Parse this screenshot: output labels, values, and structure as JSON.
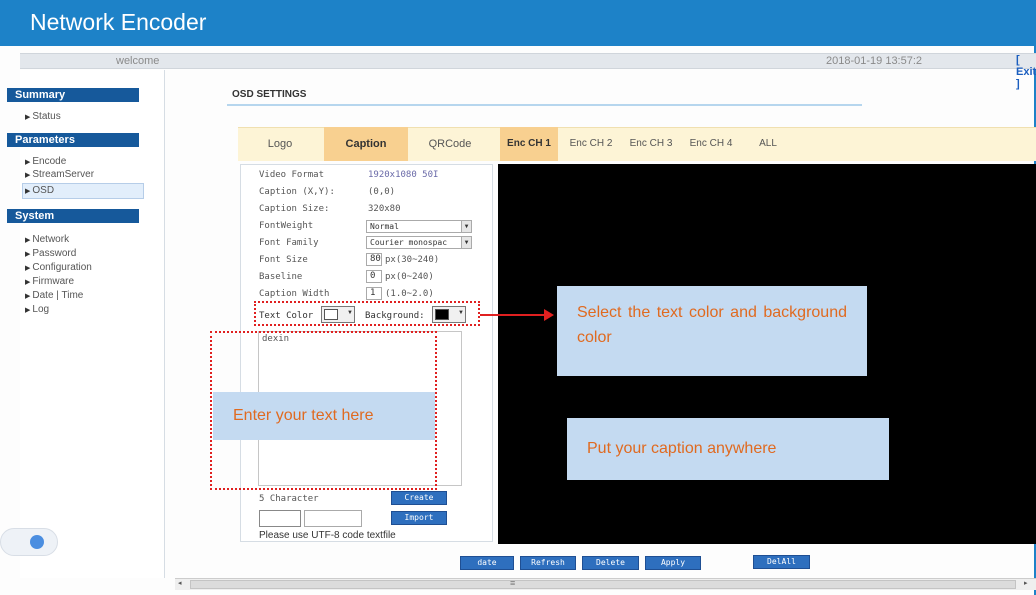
{
  "app": {
    "title": "Network Encoder"
  },
  "topbar": {
    "welcome": "welcome",
    "datetime": "2018-01-19 13:57:2",
    "exit_label": "[ Exit ]"
  },
  "sidebar": {
    "sections": [
      {
        "title": "Summary",
        "items": [
          "Status"
        ]
      },
      {
        "title": "Parameters",
        "items": [
          "Encode",
          "StreamServer",
          "OSD"
        ]
      },
      {
        "title": "System",
        "items": [
          "Network",
          "Password",
          "Configuration",
          "Firmware",
          "Date | Time",
          "Log"
        ]
      }
    ],
    "active_item": "OSD"
  },
  "page": {
    "title": "OSD SETTINGS"
  },
  "osd_tabs": [
    {
      "label": "Logo",
      "active": false
    },
    {
      "label": "Caption",
      "active": true
    },
    {
      "label": "QRCode",
      "active": false
    }
  ],
  "channel_tabs": [
    {
      "label": "Enc CH 1",
      "active": true
    },
    {
      "label": "Enc CH 2",
      "active": false
    },
    {
      "label": "Enc CH 3",
      "active": false
    },
    {
      "label": "Enc CH 4",
      "active": false
    },
    {
      "label": "ALL",
      "active": false
    }
  ],
  "form": {
    "video_format_label": "Video Format",
    "video_format_value": "1920x1080 50I",
    "caption_xy_label": "Caption (X,Y):",
    "caption_xy_value": "(0,0)",
    "caption_size_label": "Caption Size:",
    "caption_size_value": "320x80",
    "font_weight_label": "FontWeight",
    "font_weight_value": "Normal",
    "font_family_label": "Font Family",
    "font_family_value": "Courier monospac",
    "font_size_label": "Font Size",
    "font_size_value": "80",
    "font_size_range": "px(30~240)",
    "baseline_label": "Baseline",
    "baseline_value": "0",
    "baseline_range": "px(0~240)",
    "caption_width_label": "Caption Width",
    "caption_width_value": "1",
    "caption_width_range": "(1.0~2.0)",
    "text_color_label": "Text Color",
    "text_color": "#ffffff",
    "background_label": "Background:",
    "background_color": "#000000",
    "caption_text": "dexin",
    "char_count": "5 Character",
    "create_label": "Create",
    "import_label": "Import",
    "note": "Please use UTF-8 code textfile"
  },
  "actions": {
    "date_label": "date",
    "refresh_label": "Refresh",
    "delete_label": "Delete",
    "apply_label": "Apply",
    "delall_label": "DelAll"
  },
  "annotations": {
    "callout_color": "Select the text color and background color",
    "callout_text": "Enter your text here",
    "callout_caption": "Put your caption anywhere",
    "accent_color": "#e02020",
    "callout_text_color": "#e06a20"
  },
  "scrollbar": {
    "left_glyph": "◂",
    "right_glyph": "▸",
    "thumb_glyph": "≡"
  }
}
